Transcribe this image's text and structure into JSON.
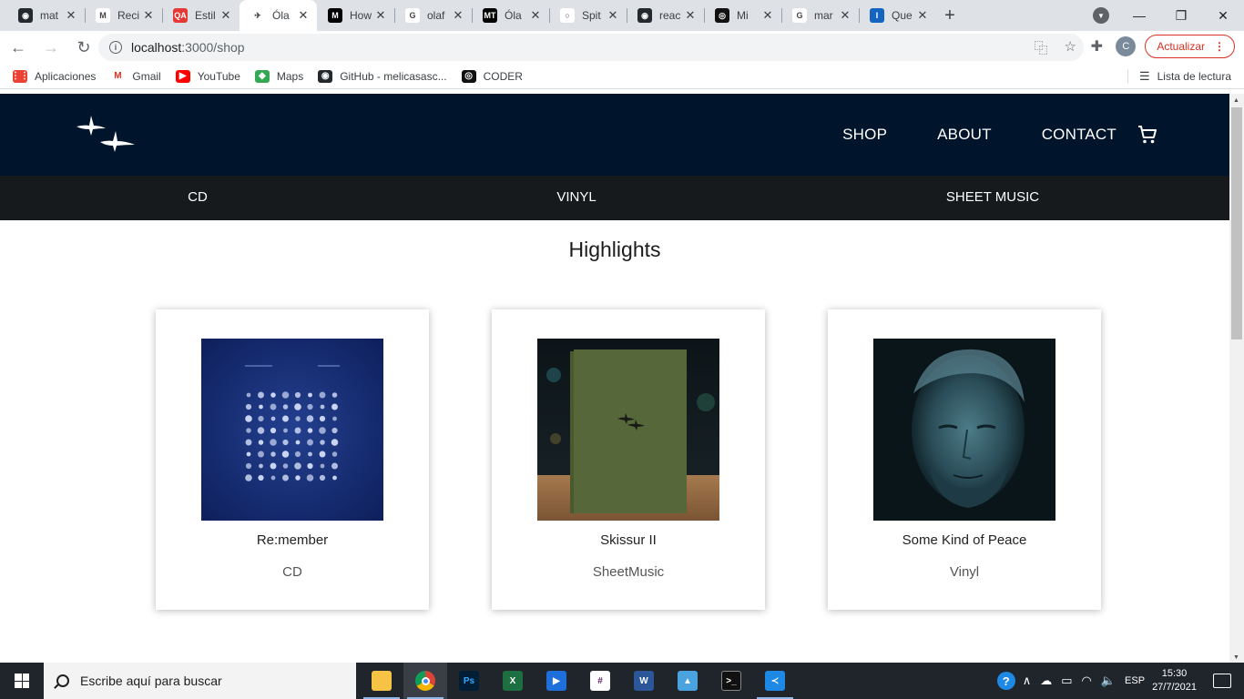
{
  "browser": {
    "tabs": [
      {
        "title": "mat",
        "icon": "github-icon",
        "color": "#24292e",
        "glyph": "◉"
      },
      {
        "title": "Reci",
        "icon": "gmail-icon",
        "color": "#ffffff",
        "glyph": "M"
      },
      {
        "title": "Estil",
        "icon": "qa-icon",
        "color": "#e53935",
        "glyph": "QA"
      },
      {
        "title": "Óla",
        "icon": "birds-icon",
        "color": "#ffffff",
        "glyph": "✈"
      },
      {
        "title": "How",
        "icon": "medium-icon",
        "color": "#000000",
        "glyph": "M"
      },
      {
        "title": "olaf",
        "icon": "google-icon",
        "color": "#ffffff",
        "glyph": "G"
      },
      {
        "title": "Óla",
        "icon": "mt-icon",
        "color": "#000000",
        "glyph": "MT"
      },
      {
        "title": "Spit",
        "icon": "loading-icon",
        "color": "#ffffff",
        "glyph": "○"
      },
      {
        "title": "reac",
        "icon": "github-icon",
        "color": "#24292e",
        "glyph": "◉"
      },
      {
        "title": "Mi",
        "icon": "coder-icon",
        "color": "#111111",
        "glyph": "◎"
      },
      {
        "title": "mar",
        "icon": "google-icon",
        "color": "#ffffff",
        "glyph": "G"
      },
      {
        "title": "Que",
        "icon": "info-icon",
        "color": "#1565c0",
        "glyph": "I"
      }
    ],
    "active_tab_index": 3,
    "url_host": "localhost",
    "url_path": ":3000/shop",
    "update_label": "Actualizar",
    "profile_initial": "C",
    "bookmarks": [
      {
        "label": "Aplicaciones",
        "icon": "apps-grid-icon"
      },
      {
        "label": "Gmail",
        "icon": "gmail-icon"
      },
      {
        "label": "YouTube",
        "icon": "youtube-icon"
      },
      {
        "label": "Maps",
        "icon": "maps-icon"
      },
      {
        "label": "GitHub - melicasasc...",
        "icon": "github-icon"
      },
      {
        "label": "CODER",
        "icon": "coder-icon"
      }
    ],
    "reading_list_label": "Lista de lectura"
  },
  "site": {
    "nav": {
      "shop": "SHOP",
      "about": "ABOUT",
      "contact": "CONTACT"
    },
    "categories": [
      "CD",
      "VINYL",
      "SHEET MUSIC"
    ],
    "highlights_title": "Highlights",
    "products": [
      {
        "name": "Re:member",
        "category": "CD",
        "art": "remember-cover"
      },
      {
        "name": "Skissur II",
        "category": "SheetMusic",
        "art": "skissur-book"
      },
      {
        "name": "Some Kind of Peace",
        "category": "Vinyl",
        "art": "portrait-photo"
      }
    ],
    "colors": {
      "header_bg": "#00152b",
      "catbar_bg": "#161a1d"
    }
  },
  "taskbar": {
    "search_placeholder": "Escribe aquí para buscar",
    "language": "ESP",
    "time": "15:30",
    "date": "27/7/2021"
  }
}
